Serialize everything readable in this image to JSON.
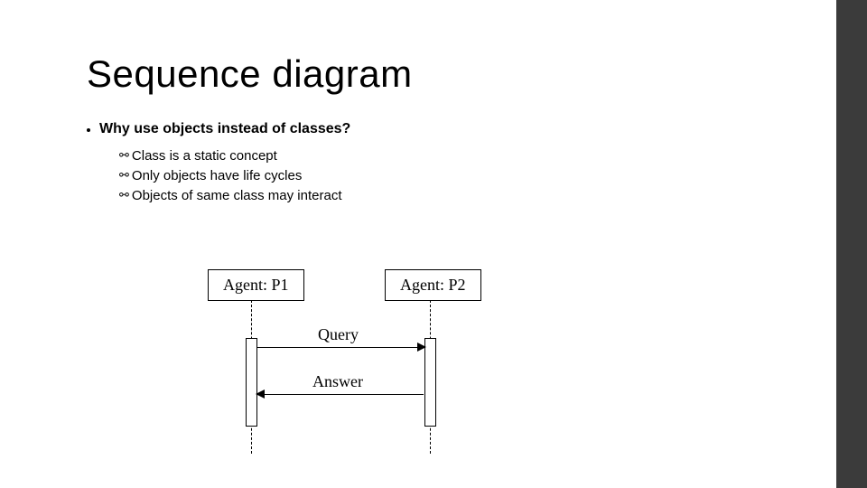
{
  "title": "Sequence diagram",
  "question": "Why use objects instead of classes?",
  "points": {
    "a": "Class is a static concept",
    "b": "Only objects have life cycles",
    "c": "Objects of same class may interact"
  },
  "diagram": {
    "participant1": "Agent: P1",
    "participant2": "Agent: P2",
    "message1": "Query",
    "message2": "Answer"
  }
}
